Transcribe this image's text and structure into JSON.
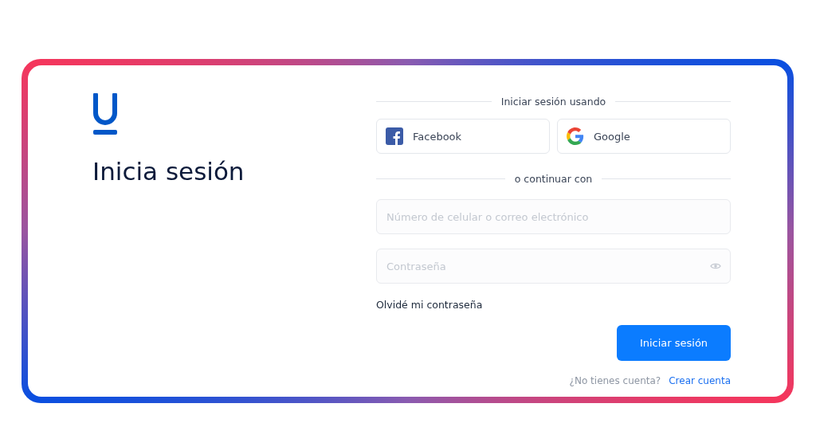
{
  "heading": "Inicia sesión",
  "social_heading": "Iniciar sesión usando",
  "social_buttons": [
    {
      "kind": "facebook",
      "label": "Facebook"
    },
    {
      "kind": "google",
      "label": "Google"
    }
  ],
  "divider_text": "o continuar con",
  "fields": [
    {
      "kind": "text",
      "placeholder": "Número de celular o correo electrónico"
    },
    {
      "kind": "password",
      "placeholder": "Contraseña"
    }
  ],
  "forgot_link": "Olvidé mi contraseña",
  "submit_button": "Iniciar sesión",
  "signup_prompt": "¿No tienes cuenta?",
  "signup_link": "Crear cuenta"
}
